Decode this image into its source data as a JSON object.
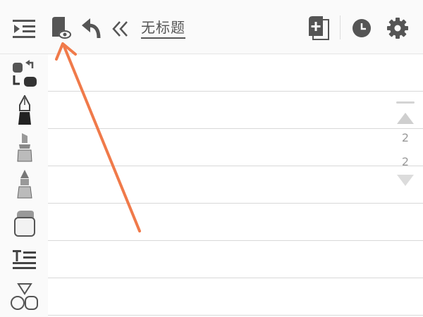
{
  "document": {
    "title": "无标题"
  },
  "pager": {
    "current": "2",
    "total": "2"
  },
  "icons": {
    "menu": "menu-icon",
    "preview": "page-preview-icon",
    "undo": "undo-icon",
    "collapse": "double-chevron-left-icon",
    "add_page": "add-page-icon",
    "history": "clock-icon",
    "settings": "gear-icon"
  },
  "tools": [
    "lasso-icon",
    "pen-icon",
    "highlighter-icon",
    "marker-icon",
    "eraser-icon",
    "text-icon",
    "shapes-icon"
  ],
  "colors": {
    "icon": "#555555",
    "annotation_arrow": "#f07a4a",
    "ruled_line": "#d8d8d8"
  }
}
